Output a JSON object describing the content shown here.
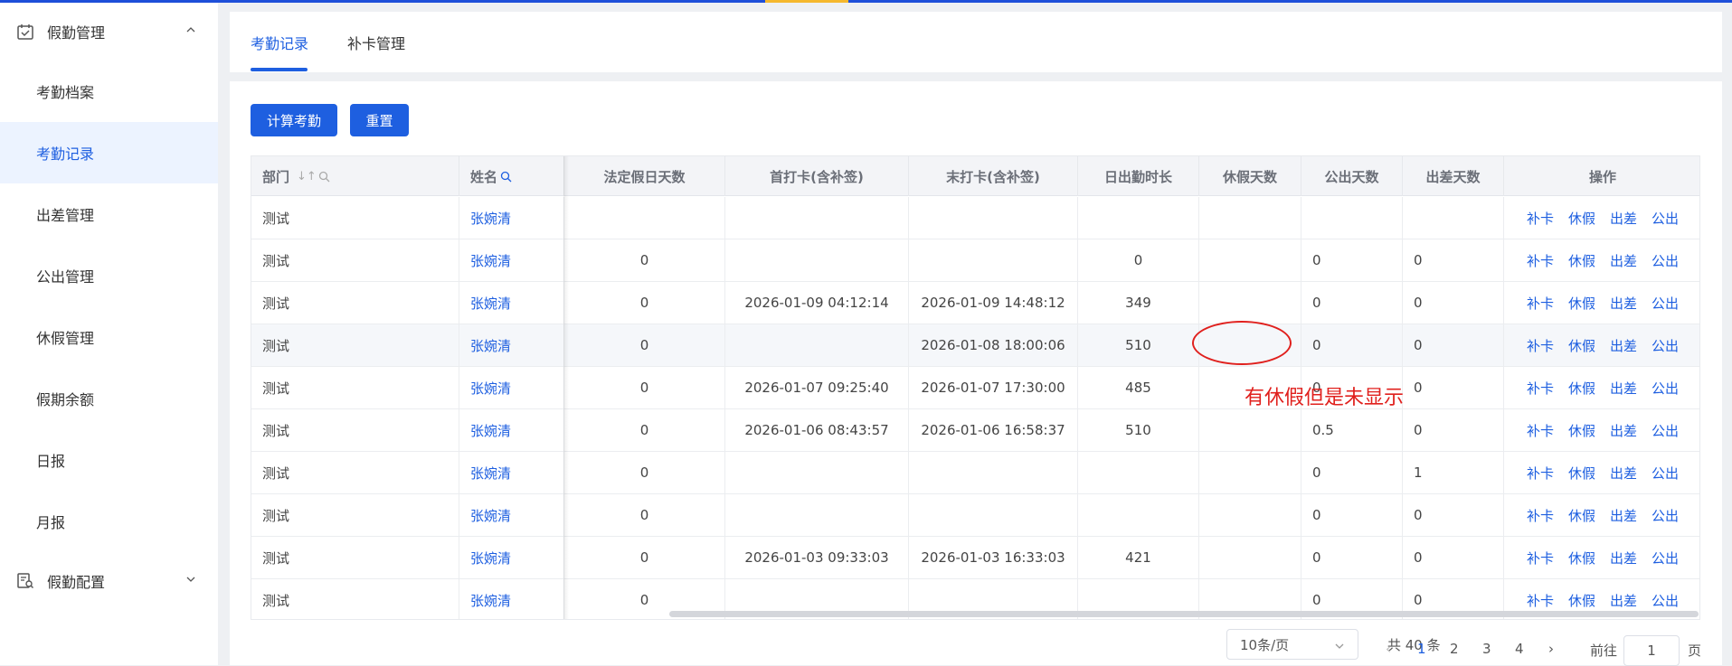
{
  "sidebar": {
    "group1": "假勤管理",
    "items": [
      "考勤档案",
      "考勤记录",
      "出差管理",
      "公出管理",
      "休假管理",
      "假期余额",
      "日报",
      "月报"
    ],
    "active_index": 1,
    "group2": "假勤配置"
  },
  "tabs": [
    "考勤记录",
    "补卡管理"
  ],
  "buttons": {
    "calculate": "计算考勤",
    "reset": "重置"
  },
  "table": {
    "headers": [
      "部门",
      "姓名",
      "法定假日天数",
      "首打卡(含补签)",
      "末打卡(含补签)",
      "日出勤时长",
      "休假天数",
      "公出天数",
      "出差天数",
      "操作"
    ],
    "ops": [
      "补卡",
      "休假",
      "出差",
      "公出"
    ],
    "rows": [
      {
        "dept": "测试",
        "name": "张婉清",
        "holiday": "",
        "first": "",
        "last": "",
        "hours": "",
        "leave": "",
        "out": "",
        "trip": ""
      },
      {
        "dept": "测试",
        "name": "张婉清",
        "holiday": "0",
        "first": "",
        "last": "",
        "hours": "0",
        "leave": "",
        "out": "0",
        "trip": "0"
      },
      {
        "dept": "测试",
        "name": "张婉清",
        "holiday": "0",
        "first": "2026-01-09 04:12:14",
        "last": "2026-01-09 14:48:12",
        "hours": "349",
        "leave": "",
        "out": "0",
        "trip": "0"
      },
      {
        "dept": "测试",
        "name": "张婉清",
        "holiday": "0",
        "first": "",
        "last": "2026-01-08 18:00:06",
        "hours": "510",
        "leave": "",
        "out": "0",
        "trip": "0"
      },
      {
        "dept": "测试",
        "name": "张婉清",
        "holiday": "0",
        "first": "2026-01-07 09:25:40",
        "last": "2026-01-07 17:30:00",
        "hours": "485",
        "leave": "",
        "out": "0",
        "trip": "0"
      },
      {
        "dept": "测试",
        "name": "张婉清",
        "holiday": "0",
        "first": "2026-01-06 08:43:57",
        "last": "2026-01-06 16:58:37",
        "hours": "510",
        "leave": "",
        "out": "0.5",
        "trip": "0"
      },
      {
        "dept": "测试",
        "name": "张婉清",
        "holiday": "0",
        "first": "",
        "last": "",
        "hours": "",
        "leave": "",
        "out": "0",
        "trip": "1"
      },
      {
        "dept": "测试",
        "name": "张婉清",
        "holiday": "0",
        "first": "",
        "last": "",
        "hours": "",
        "leave": "",
        "out": "0",
        "trip": "0"
      },
      {
        "dept": "测试",
        "name": "张婉清",
        "holiday": "0",
        "first": "2026-01-03 09:33:03",
        "last": "2026-01-03 16:33:03",
        "hours": "421",
        "leave": "",
        "out": "0",
        "trip": "0"
      },
      {
        "dept": "测试",
        "name": "张婉清",
        "holiday": "0",
        "first": "",
        "last": "",
        "hours": "",
        "leave": "",
        "out": "0",
        "trip": "0"
      }
    ]
  },
  "annotation": {
    "text": "有休假但是未显示"
  },
  "pagination": {
    "total": "共 40 条",
    "page_size": "10条/页",
    "pages": [
      "1",
      "2",
      "3",
      "4"
    ],
    "current": "1",
    "goto_label": "前往",
    "goto_value": "1",
    "page_suffix": "页"
  },
  "colors": {
    "primary": "#1e5fe0",
    "annotation": "#e0201d",
    "accent_bar": "#f5b82e"
  }
}
